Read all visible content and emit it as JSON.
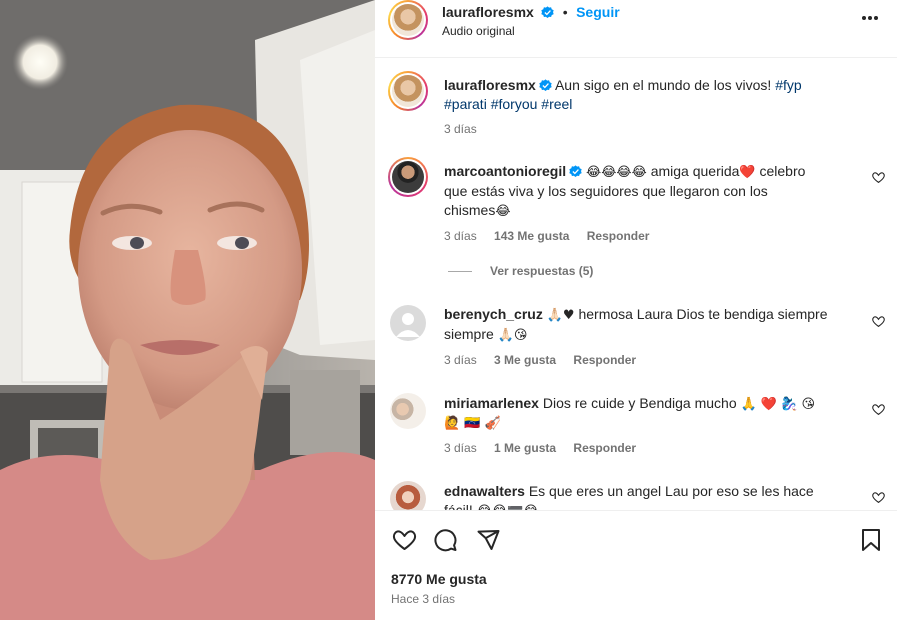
{
  "header": {
    "username": "laurafloresmx",
    "separator": "•",
    "follow_label": "Seguir",
    "audio_label": "Audio original",
    "more_icon": "more-horizontal-icon"
  },
  "caption": {
    "username": "laurafloresmx",
    "text": "Aun sigo en el mundo de los vivos!",
    "hashtags_line1": "#fyp",
    "hashtags_line2": "#parati #foryou #reel",
    "time": "3 días"
  },
  "comments": [
    {
      "username": "marcoantonioregil",
      "verified": true,
      "line1_emoji": "😂😂😂😂",
      "line1_text": "amiga querida",
      "line1_emoji2": "❤️",
      "line1_text2": "celebro",
      "line2": "que estás viva y los seguidores que llegaron con los",
      "line3_text": "chismes",
      "line3_emoji": "😂",
      "time": "3 días",
      "likes": "143 Me gusta",
      "reply": "Responder",
      "view_replies": "Ver respuestas (5)"
    },
    {
      "username": "berenych_cruz",
      "line1_emoji": "🙏🏻♥",
      "line1_text": "hermosa Laura Dios te bendiga siempre",
      "line2_text": "siempre",
      "line2_emoji": "🙏🏻😘",
      "time": "3 días",
      "likes": "3 Me gusta",
      "reply": "Responder"
    },
    {
      "username": "miriamarlenex",
      "line1_text": "Dios re cuide y Bendiga mucho",
      "line1_emoji": "🙏 ❤️ 🧞‍♀️ 😘",
      "line2_emoji": "🙋 🇻🇪 🎻",
      "time": "3 días",
      "likes": "1 Me gusta",
      "reply": "Responder"
    },
    {
      "username": "ednawalters",
      "line1_text": "Es que eres un angel Lau por eso se les hace",
      "line2_text": "fácil!",
      "line2_emoji": "😂😂🟰😂"
    }
  ],
  "actions": {
    "like_icon": "heart-icon",
    "comment_icon": "comment-icon",
    "share_icon": "send-icon",
    "save_icon": "bookmark-icon"
  },
  "footer": {
    "likes": "8770 Me gusta",
    "time": "Hace 3 días"
  },
  "colors": {
    "link_blue": "#0095f6",
    "verified_blue": "#0095f6",
    "hashtag": "#00376b",
    "muted": "#737373",
    "divider": "#efefef"
  }
}
